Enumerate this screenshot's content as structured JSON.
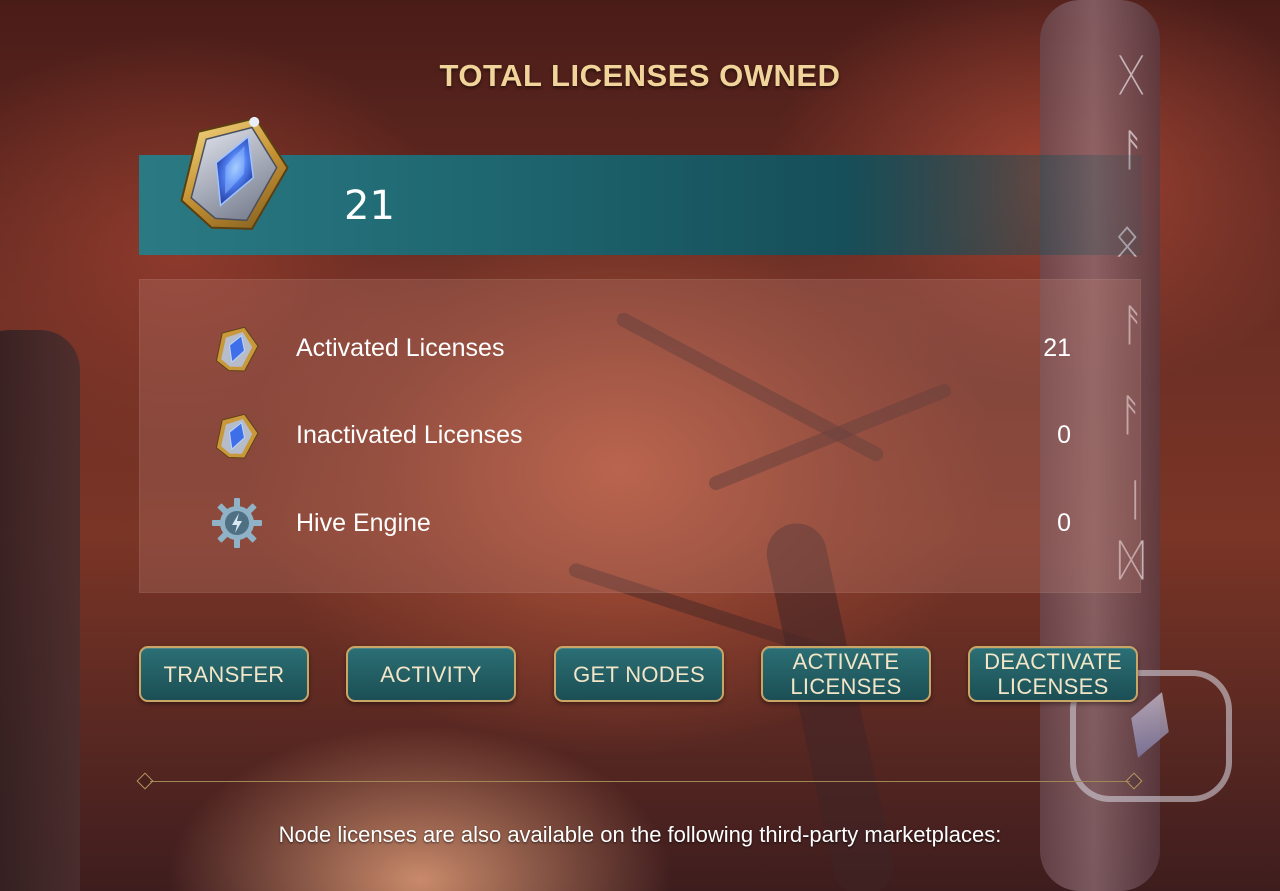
{
  "page": {
    "title": "TOTAL LICENSES OWNED",
    "total_licenses": "21"
  },
  "breakdown": [
    {
      "label": "Activated Licenses",
      "value": "21",
      "icon": "license-gem-icon"
    },
    {
      "label": "Inactivated Licenses",
      "value": "0",
      "icon": "license-gem-icon"
    },
    {
      "label": "Hive Engine",
      "value": "0",
      "icon": "hive-engine-gear-icon"
    }
  ],
  "actions": {
    "transfer": "TRANSFER",
    "activity": "ACTIVITY",
    "get_nodes": "GET NODES",
    "activate_line1": "ACTIVATE",
    "activate_line2": "LICENSES",
    "deactivate_line1": "DEACTIVATE",
    "deactivate_line2": "LICENSES"
  },
  "footer_note": "Node licenses are also available on the following third-party marketplaces:",
  "colors": {
    "title_gold": "#f0d49a",
    "button_teal": "#1b4f55",
    "button_border": "#c9a566",
    "bar_teal": "#1e6670"
  }
}
